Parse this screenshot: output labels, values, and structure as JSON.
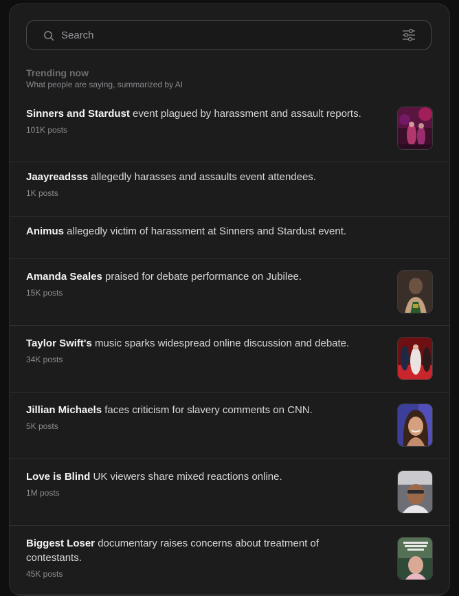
{
  "search": {
    "placeholder": "Search",
    "icon": "search-icon",
    "filter_icon": "filter-sliders-icon"
  },
  "section": {
    "title": "Trending now",
    "subtitle": "What people are saying, summarized by AI"
  },
  "items": [
    {
      "topic": "Sinners and Stardust",
      "summary": " event plagued by harassment and assault reports.",
      "count": "101K posts",
      "thumb": "event-photo",
      "colors": [
        "#3a0f2a",
        "#b3205e",
        "#e24a8a",
        "#7a1a6e"
      ]
    },
    {
      "topic": "Jaayreadsss",
      "summary": " allegedly harasses and assaults event attendees.",
      "count": "1K posts"
    },
    {
      "topic": "Animus",
      "summary": " allegedly victim of harassment at Sinners and Stardust event.",
      "count": ""
    },
    {
      "topic": "Amanda Seales",
      "summary": " praised for debate performance on Jubilee.",
      "count": "15K posts",
      "thumb": "person-photo",
      "colors": [
        "#2a2320",
        "#6b5344",
        "#c2a27e",
        "#2b5a2c"
      ]
    },
    {
      "topic": "Taylor Swift's",
      "summary": " music sparks widespread online discussion and debate.",
      "count": "34K posts",
      "thumb": "red-carpet-photo",
      "colors": [
        "#6e0f14",
        "#c8262c",
        "#e9e4df",
        "#1c2a45"
      ]
    },
    {
      "topic": "Jillian Michaels",
      "summary": " faces criticism for slavery comments on CNN.",
      "count": "5K posts",
      "thumb": "portrait-photo",
      "colors": [
        "#3b3f9a",
        "#5b57c9",
        "#d4a07f",
        "#3a2418"
      ]
    },
    {
      "topic": "Love is Blind",
      "summary": " UK viewers share mixed reactions online.",
      "count": "1M posts",
      "thumb": "video-selfie",
      "colors": [
        "#8a8a92",
        "#c9c9ce",
        "#9c6a4b",
        "#2b2b30"
      ]
    },
    {
      "topic": "Biggest Loser",
      "summary": " documentary raises concerns about treatment of contestants.",
      "count": "45K posts",
      "thumb": "video-selfie-caption",
      "colors": [
        "#2f4a36",
        "#6f8c6a",
        "#d9a896",
        "#e9e9e9"
      ]
    }
  ]
}
